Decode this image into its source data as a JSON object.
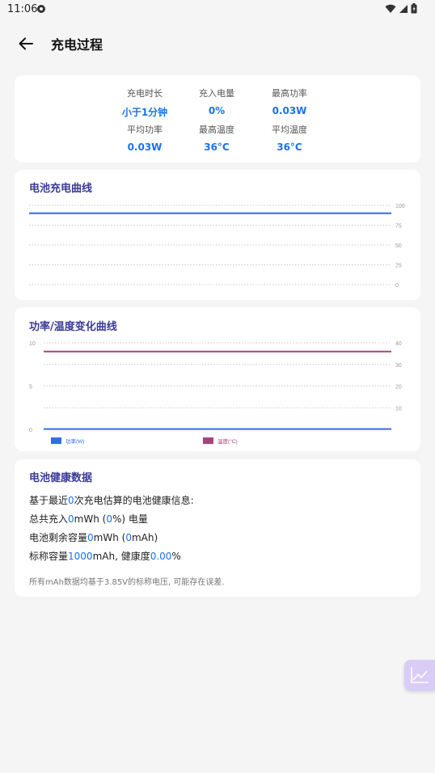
{
  "status_bar": {
    "time": "11:06"
  },
  "header": {
    "title": "充电过程"
  },
  "stats": [
    {
      "label": "充电时长",
      "value": "小于1分钟"
    },
    {
      "label": "充入电量",
      "value": "0%"
    },
    {
      "label": "最高功率",
      "value": "0.03W"
    },
    {
      "label": "平均功率",
      "value": "0.03W"
    },
    {
      "label": "最高温度",
      "value": "36°C"
    },
    {
      "label": "平均温度",
      "value": "36°C"
    }
  ],
  "battery_chart": {
    "title": "电池充电曲线",
    "chart_data": {
      "type": "line",
      "y_ticks": [
        "100",
        "75",
        "50",
        "25",
        "0"
      ],
      "ylim": [
        0,
        100
      ],
      "series": [
        {
          "values": [
            90,
            90
          ],
          "color": "#2f6fe0"
        }
      ]
    }
  },
  "power_chart": {
    "title": "功率/温度变化曲线",
    "chart_data": {
      "type": "line",
      "left_y_ticks": [
        "10",
        "5",
        "0"
      ],
      "left_ylim": [
        0,
        10
      ],
      "right_y_ticks": [
        "40",
        "30",
        "20",
        "10"
      ],
      "right_ylim": [
        0,
        40
      ],
      "series": [
        {
          "name": "功率(W)",
          "values": [
            0.03,
            0.03
          ],
          "axis": "left",
          "color": "#2f6fe0"
        },
        {
          "name": "温度(°C)",
          "values": [
            36,
            36
          ],
          "axis": "right",
          "color": "#a94478"
        }
      ]
    }
  },
  "health": {
    "title": "电池健康数据",
    "line1": {
      "a": "基于最近",
      "n1": "0",
      "b": "次充电估算的电池健康信息:"
    },
    "line2": {
      "a": "总共充入",
      "n1": "0",
      "b": "mWh (",
      "n2": "0",
      "c": "%) 电量"
    },
    "line3": {
      "a": "电池剩余容量",
      "n1": "0",
      "b": "mWh (",
      "n2": "0",
      "c": "mAh)"
    },
    "line4": {
      "a": "标称容量",
      "n1": "1000",
      "b": "mAh, 健康度",
      "n2": "0.00",
      "c": "%"
    },
    "note": "所有mAh数据均基于3.85V的标称电压, 可能存在误差."
  },
  "colors": {
    "accent": "#1a73e8",
    "title": "#3b3b96",
    "fab": "#d9ccf6"
  }
}
